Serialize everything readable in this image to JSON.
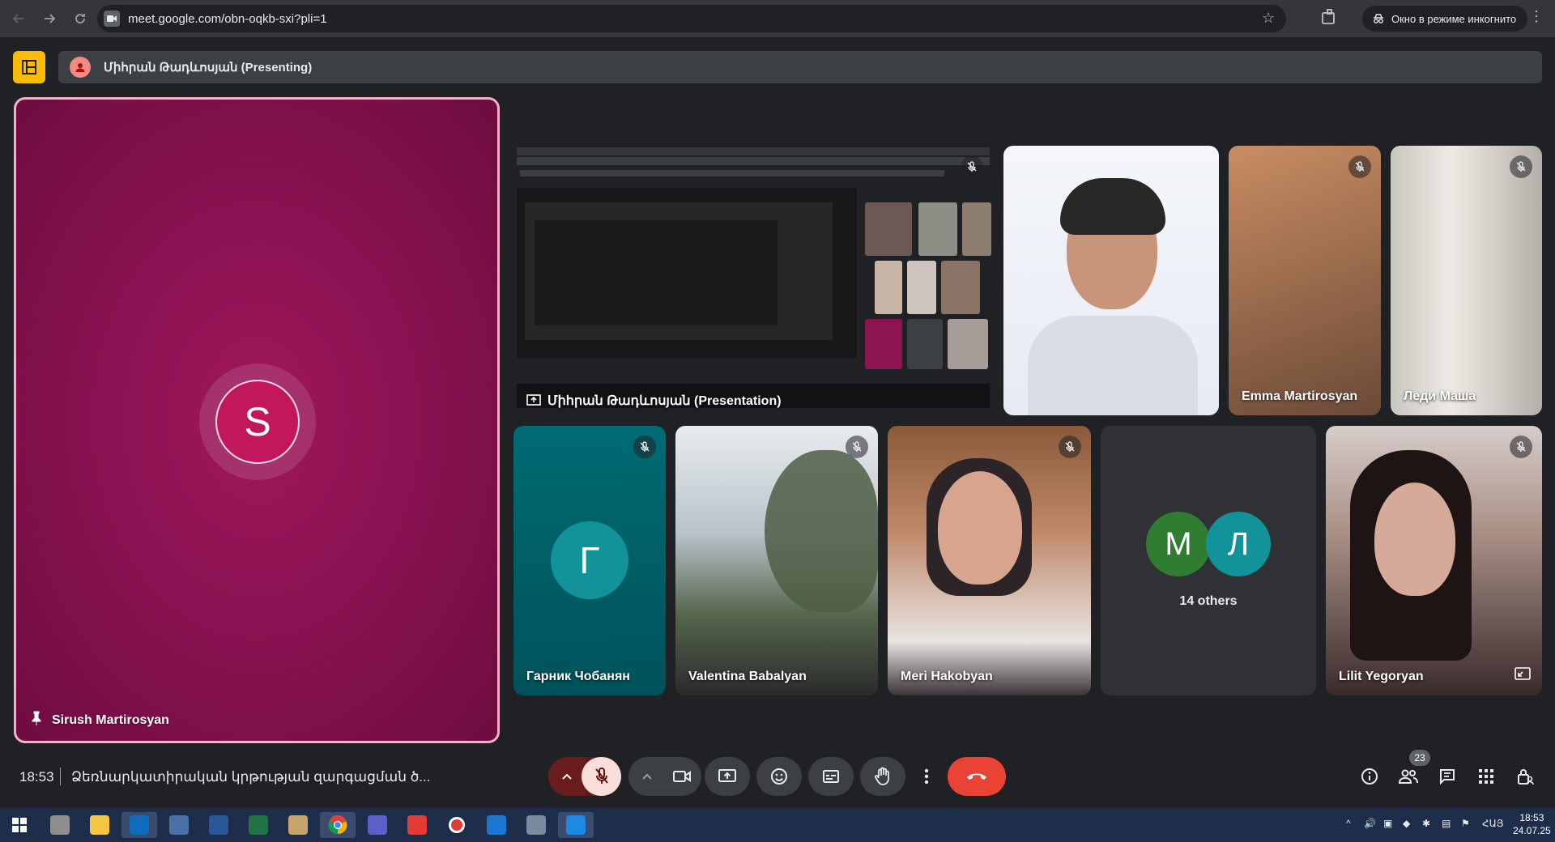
{
  "browser": {
    "url": "meet.google.com/obn-oqkb-sxi?pli=1",
    "incognito_label": "Окно в режиме инкогнито"
  },
  "meet": {
    "presenting_banner": "Միհրան Թադևոսյան (Presenting)",
    "pinned": {
      "name": "Sirush Martirosyan",
      "initial": "S"
    },
    "presentation_label": "Միհրան Թադևոսյան (Presentation)",
    "tiles": [
      {
        "name": "Emma Martirosyan"
      },
      {
        "name": "Леди Маша"
      },
      {
        "name": "Гарник Чобанян",
        "initial": "Г"
      },
      {
        "name": "Valentina Babalyan"
      },
      {
        "name": "Meri Hakobyan"
      },
      {
        "initials": [
          "М",
          "Л"
        ],
        "text": "14 others"
      },
      {
        "name": "Lilit Yegoryan"
      }
    ],
    "bottom_bar": {
      "time": "18:53",
      "title": "Ձեռնարկատիրական կրթության զարգացման ծ...",
      "participants_count": "23"
    }
  },
  "taskbar": {
    "tray_lang": "ՀԱՅ",
    "clock_time": "18:53",
    "clock_date": "24.07.25"
  },
  "colors": {
    "accent_pink": "#f6aec9",
    "hangup": "#ea4335",
    "teal_avatar": "#12939a",
    "green_avatar": "#2e7d32"
  }
}
